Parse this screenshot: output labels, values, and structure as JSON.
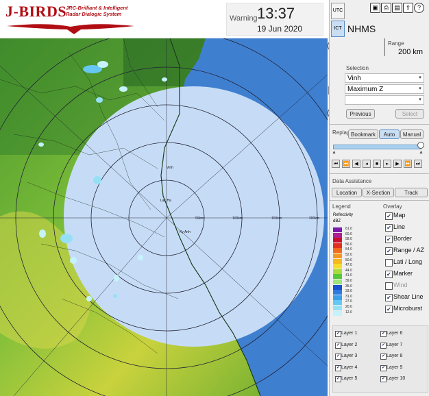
{
  "header": {
    "logo": "J-BIRDS",
    "logo_sub_line1": "JRC-Brilliant & Intelligent",
    "logo_sub_line2": "Radar Dialogic System",
    "warning_label": "Warning",
    "time": "13:37",
    "date": "19 Jun 2020"
  },
  "timezones": {
    "utc": "UTC",
    "ict": "ICT"
  },
  "toolbar_icons": [
    "save-icon",
    "print-icon",
    "folder-icon",
    "export-icon",
    "help-icon"
  ],
  "station": "NHMS",
  "range": {
    "label": "Range",
    "value": "200 km"
  },
  "selection": {
    "label": "Selection",
    "site": "Vinh",
    "product": "Maximum Z",
    "extra": "",
    "previous": "Previous",
    "select": "Select"
  },
  "replay": {
    "label": "Replay",
    "bookmark": "Bookmark",
    "auto": "Auto",
    "manual": "Manual"
  },
  "assist": {
    "label": "Data Assistance",
    "location": "Location",
    "xsection": "X-Section",
    "track": "Track"
  },
  "legend": {
    "title": "Legend",
    "product": "Reflectivity",
    "unit": "dBZ",
    "levels": [
      {
        "v": "61.0",
        "c": "#7a1aa8"
      },
      {
        "v": "60.0",
        "c": "#b02090"
      },
      {
        "v": "58.0",
        "c": "#c8102e"
      },
      {
        "v": "56.0",
        "c": "#e03020"
      },
      {
        "v": "54.0",
        "c": "#f06a20"
      },
      {
        "v": "52.0",
        "c": "#f5961e"
      },
      {
        "v": "50.0",
        "c": "#f5b81e"
      },
      {
        "v": "47.0",
        "c": "#f5dc2a"
      },
      {
        "v": "44.0",
        "c": "#a6dc3c"
      },
      {
        "v": "41.0",
        "c": "#56c83a"
      },
      {
        "v": "39.0",
        "c": "#9be37a"
      },
      {
        "v": "35.0",
        "c": "#1a4fd0"
      },
      {
        "v": "33.0",
        "c": "#2a7ae0"
      },
      {
        "v": "31.0",
        "c": "#3aa0ea"
      },
      {
        "v": "27.0",
        "c": "#66c8f2"
      },
      {
        "v": "20.0",
        "c": "#96e0f6"
      },
      {
        "v": "12.0",
        "c": "#c6f2fb"
      }
    ]
  },
  "overlay": {
    "title": "Overlay",
    "items": [
      {
        "label": "Map",
        "checked": true
      },
      {
        "label": "Line",
        "checked": true
      },
      {
        "label": "Border",
        "checked": true
      },
      {
        "label": "Range / AZ",
        "checked": true
      },
      {
        "label": "Lati / Long",
        "checked": false
      },
      {
        "label": "Marker",
        "checked": true
      },
      {
        "label": "Wind",
        "checked": false
      },
      {
        "label": "Shear Line",
        "checked": true
      },
      {
        "label": "Microburst",
        "checked": true
      }
    ]
  },
  "layers": [
    {
      "label": "Layer 1",
      "checked": true
    },
    {
      "label": "Layer 6",
      "checked": true
    },
    {
      "label": "Layer 2",
      "checked": true
    },
    {
      "label": "Layer 7",
      "checked": true
    },
    {
      "label": "Layer 3",
      "checked": true
    },
    {
      "label": "Layer 8",
      "checked": true
    },
    {
      "label": "Layer 4",
      "checked": true
    },
    {
      "label": "Layer 9",
      "checked": true
    },
    {
      "label": "Layer 5",
      "checked": true
    },
    {
      "label": "Layer 10",
      "checked": true
    }
  ],
  "map": {
    "range_labels": [
      "50km",
      "100km",
      "150km",
      "200km"
    ],
    "places": [
      "Vinh",
      "Lac Ha",
      "Ky Anh"
    ]
  }
}
